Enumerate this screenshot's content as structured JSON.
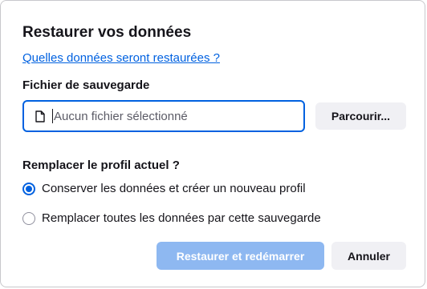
{
  "dialog": {
    "title": "Restaurer vos données",
    "help_link": "Quelles données seront restaurées ?"
  },
  "backup_file": {
    "label": "Fichier de sauvegarde",
    "placeholder": "Aucun fichier sélectionné",
    "browse_label": "Parcourir...",
    "icon": "file-icon"
  },
  "profile": {
    "label": "Remplacer le profil actuel ?",
    "options": [
      {
        "label": "Conserver les données et créer un nouveau profil",
        "selected": true
      },
      {
        "label": "Remplacer toutes les données par cette sauvegarde",
        "selected": false
      }
    ]
  },
  "actions": {
    "restore_label": "Restaurer et redémarrer",
    "cancel_label": "Annuler"
  },
  "colors": {
    "accent": "#0061e0",
    "disabled_primary": "#8eb8f1",
    "secondary_button": "#f0f0f4"
  }
}
